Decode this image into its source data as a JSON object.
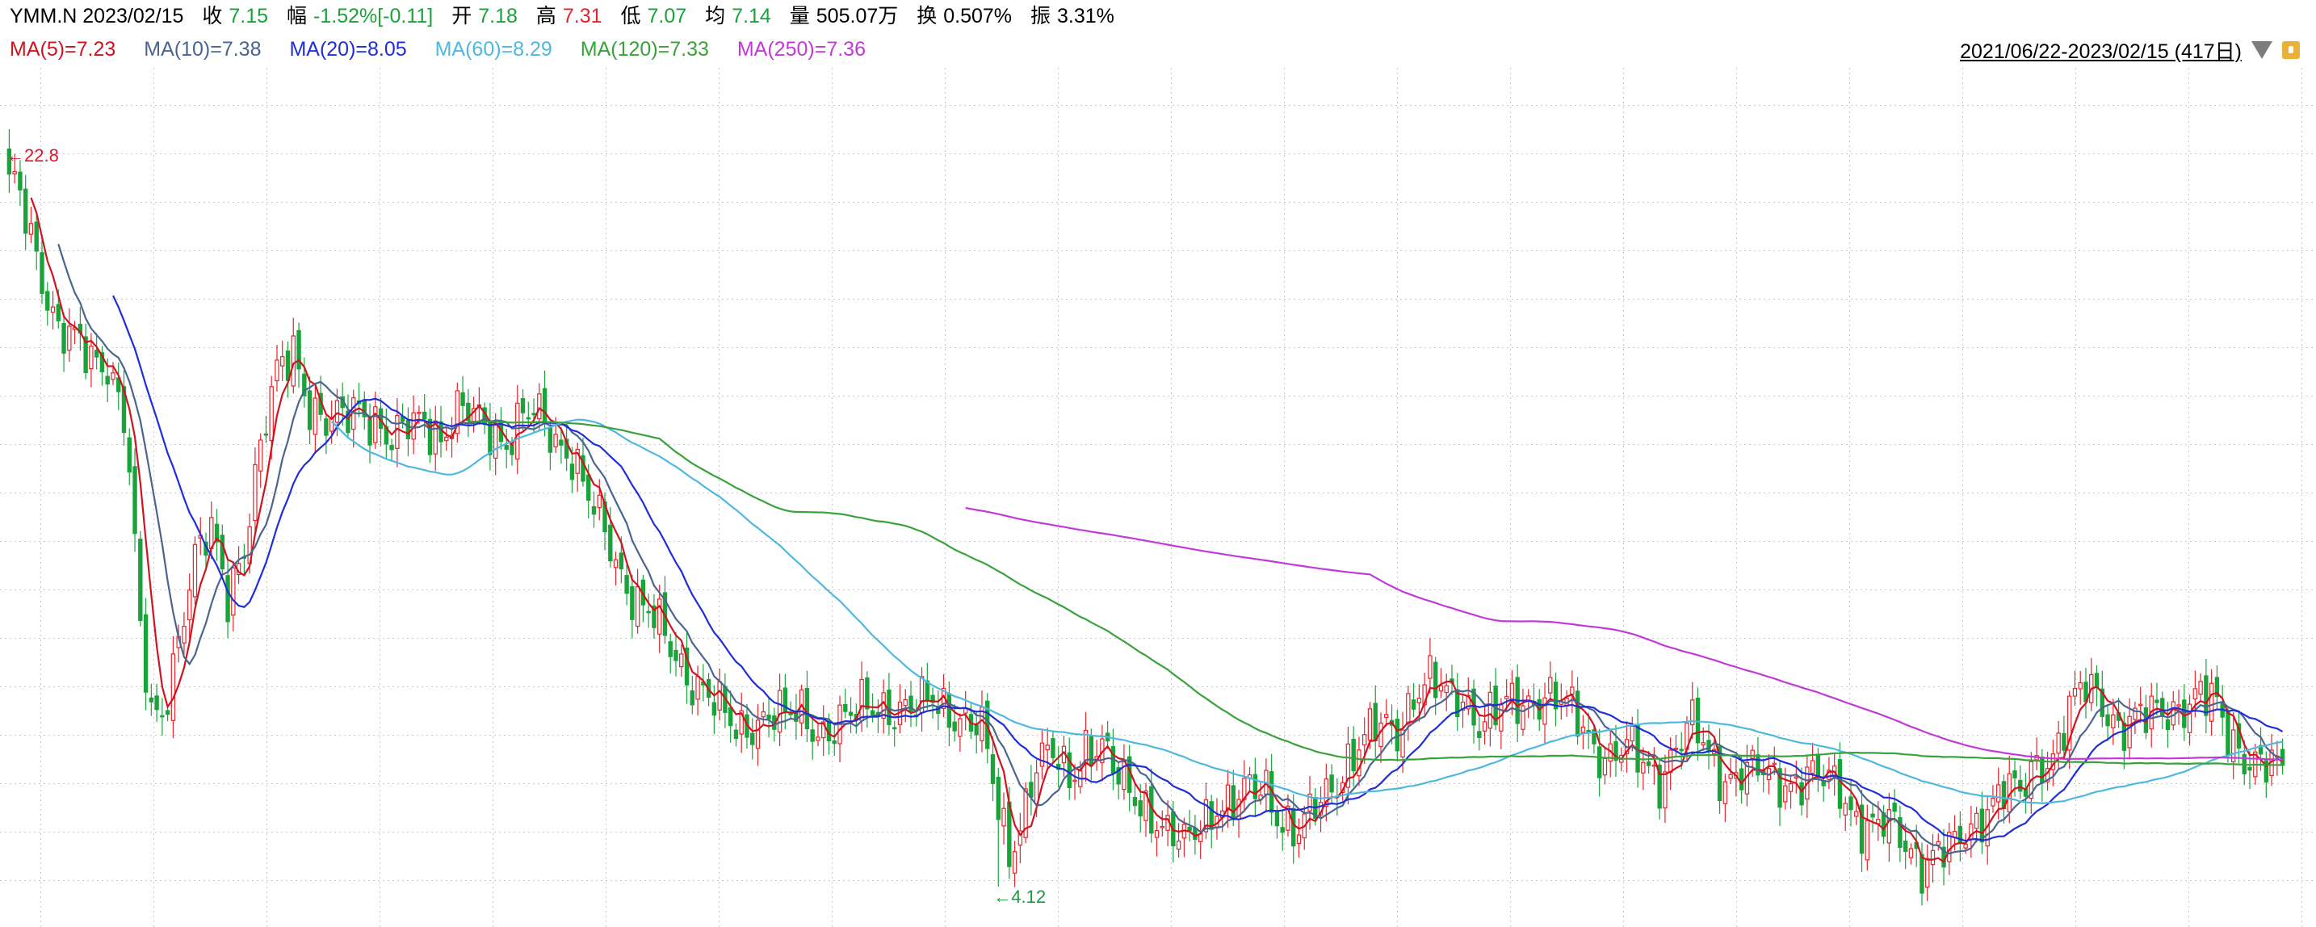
{
  "header": {
    "symbol": "YMM.N",
    "date": "2023/02/15",
    "close_label": "收",
    "close": "7.15",
    "range_label": "幅",
    "change": "-1.52%[-0.11]",
    "open_label": "开",
    "open": "7.18",
    "high_label": "高",
    "high": "7.31",
    "low_label": "低",
    "low": "7.07",
    "avg_label": "均",
    "avg": "7.14",
    "volume_label": "量",
    "volume": "505.07万",
    "turnover_label": "换",
    "turnover": "0.507%",
    "amplitude_label": "振",
    "amplitude": "3.31%"
  },
  "ma_legend": [
    {
      "text": "MA(5)=7.23",
      "color": "#d0141f"
    },
    {
      "text": "MA(10)=7.38",
      "color": "#4a6590"
    },
    {
      "text": "MA(20)=8.05",
      "color": "#1f2ed6"
    },
    {
      "text": "MA(60)=8.29",
      "color": "#4fb8e0"
    },
    {
      "text": "MA(120)=7.33",
      "color": "#3aa23a"
    },
    {
      "text": "MA(250)=7.36",
      "color": "#c03ad6"
    }
  ],
  "range": {
    "text": "2021/06/22-2023/02/15 (417日)"
  },
  "colors": {
    "up": "#e5242b",
    "down": "#1aa33a",
    "grid": "#c8c8c8",
    "high_mark": "#e0142a",
    "low_mark": "#1a9a3a"
  },
  "chart_data": {
    "type": "candlestick",
    "x_range": [
      "2021/06/22",
      "2023/02/15"
    ],
    "trading_days": 417,
    "ylim": [
      4.12,
      22.8
    ],
    "y_scale": "log",
    "grid": true,
    "annotations": {
      "high_text": "←22.8",
      "high_value": 22.8,
      "low_text": "←4.12",
      "low_value": 4.12
    },
    "close_path": [
      [
        0,
        20.5
      ],
      [
        3,
        18.8
      ],
      [
        6,
        16.5
      ],
      [
        9,
        14.5
      ],
      [
        12,
        14.0
      ],
      [
        15,
        13.5
      ],
      [
        18,
        13.6
      ],
      [
        21,
        12.0
      ],
      [
        24,
        7.2
      ],
      [
        26,
        6.0
      ],
      [
        28,
        6.1
      ],
      [
        31,
        7.3
      ],
      [
        34,
        8.6
      ],
      [
        37,
        9.1
      ],
      [
        40,
        8.0
      ],
      [
        43,
        9.0
      ],
      [
        46,
        11.0
      ],
      [
        49,
        13.0
      ],
      [
        52,
        14.0
      ],
      [
        55,
        12.3
      ],
      [
        58,
        11.6
      ],
      [
        61,
        11.8
      ],
      [
        64,
        12.3
      ],
      [
        67,
        11.9
      ],
      [
        70,
        11.1
      ],
      [
        73,
        11.6
      ],
      [
        76,
        12.0
      ],
      [
        79,
        11.4
      ],
      [
        82,
        11.9
      ],
      [
        85,
        11.9
      ],
      [
        88,
        11.7
      ],
      [
        91,
        11.3
      ],
      [
        94,
        11.8
      ],
      [
        97,
        11.9
      ],
      [
        100,
        11.4
      ],
      [
        103,
        11.0
      ],
      [
        106,
        9.8
      ],
      [
        109,
        9.1
      ],
      [
        112,
        8.4
      ],
      [
        115,
        7.9
      ],
      [
        118,
        7.5
      ],
      [
        121,
        7.0
      ],
      [
        124,
        6.7
      ],
      [
        127,
        6.5
      ],
      [
        130,
        6.1
      ],
      [
        133,
        5.8
      ],
      [
        136,
        6.0
      ],
      [
        139,
        6.15
      ],
      [
        142,
        6.0
      ],
      [
        145,
        6.05
      ],
      [
        148,
        5.9
      ],
      [
        151,
        5.95
      ],
      [
        154,
        6.0
      ],
      [
        157,
        6.2
      ],
      [
        160,
        6.25
      ],
      [
        163,
        6.15
      ],
      [
        166,
        6.1
      ],
      [
        169,
        6.3
      ],
      [
        172,
        6.2
      ],
      [
        175,
        6.0
      ],
      [
        178,
        5.8
      ],
      [
        181,
        4.9
      ],
      [
        183,
        4.5
      ],
      [
        185,
        4.8
      ],
      [
        188,
        5.4
      ],
      [
        191,
        5.5
      ],
      [
        194,
        5.3
      ],
      [
        197,
        5.7
      ],
      [
        200,
        5.6
      ],
      [
        203,
        5.2
      ],
      [
        206,
        5.1
      ],
      [
        209,
        4.9
      ],
      [
        212,
        4.6
      ],
      [
        215,
        4.5
      ],
      [
        218,
        4.8
      ],
      [
        221,
        5.0
      ],
      [
        224,
        4.9
      ],
      [
        227,
        5.1
      ],
      [
        230,
        5.2
      ],
      [
        233,
        4.8
      ],
      [
        236,
        4.6
      ],
      [
        239,
        4.9
      ],
      [
        242,
        5.2
      ],
      [
        245,
        5.5
      ],
      [
        248,
        5.7
      ],
      [
        251,
        5.9
      ],
      [
        254,
        5.9
      ],
      [
        257,
        6.4
      ],
      [
        260,
        6.5
      ],
      [
        263,
        6.3
      ],
      [
        266,
        6.4
      ],
      [
        269,
        6.0
      ],
      [
        272,
        6.05
      ],
      [
        275,
        6.2
      ],
      [
        278,
        6.3
      ],
      [
        281,
        6.4
      ],
      [
        284,
        6.2
      ],
      [
        287,
        6.0
      ],
      [
        290,
        5.7
      ],
      [
        293,
        5.55
      ],
      [
        296,
        5.6
      ],
      [
        299,
        5.4
      ],
      [
        302,
        5.3
      ],
      [
        305,
        5.7
      ],
      [
        308,
        5.9
      ],
      [
        311,
        5.5
      ],
      [
        314,
        5.3
      ],
      [
        317,
        5.4
      ],
      [
        320,
        5.3
      ],
      [
        323,
        5.2
      ],
      [
        326,
        5.25
      ],
      [
        329,
        5.35
      ],
      [
        332,
        5.2
      ],
      [
        335,
        5.1
      ],
      [
        338,
        4.85
      ],
      [
        341,
        4.75
      ],
      [
        344,
        4.7
      ],
      [
        347,
        4.5
      ],
      [
        350,
        4.4
      ],
      [
        353,
        4.5
      ],
      [
        356,
        4.45
      ],
      [
        359,
        4.65
      ],
      [
        362,
        5.0
      ],
      [
        365,
        5.2
      ],
      [
        368,
        5.0
      ],
      [
        371,
        5.4
      ],
      [
        374,
        5.6
      ],
      [
        377,
        6.2
      ],
      [
        380,
        6.4
      ],
      [
        383,
        6.2
      ],
      [
        386,
        6.0
      ],
      [
        389,
        6.05
      ],
      [
        392,
        6.0
      ],
      [
        395,
        6.1
      ],
      [
        398,
        6.3
      ],
      [
        401,
        6.4
      ],
      [
        404,
        6.1
      ],
      [
        406,
        5.75
      ],
      [
        409,
        5.6
      ],
      [
        412,
        5.5
      ],
      [
        414,
        5.4
      ],
      [
        416,
        5.25
      ]
    ]
  }
}
